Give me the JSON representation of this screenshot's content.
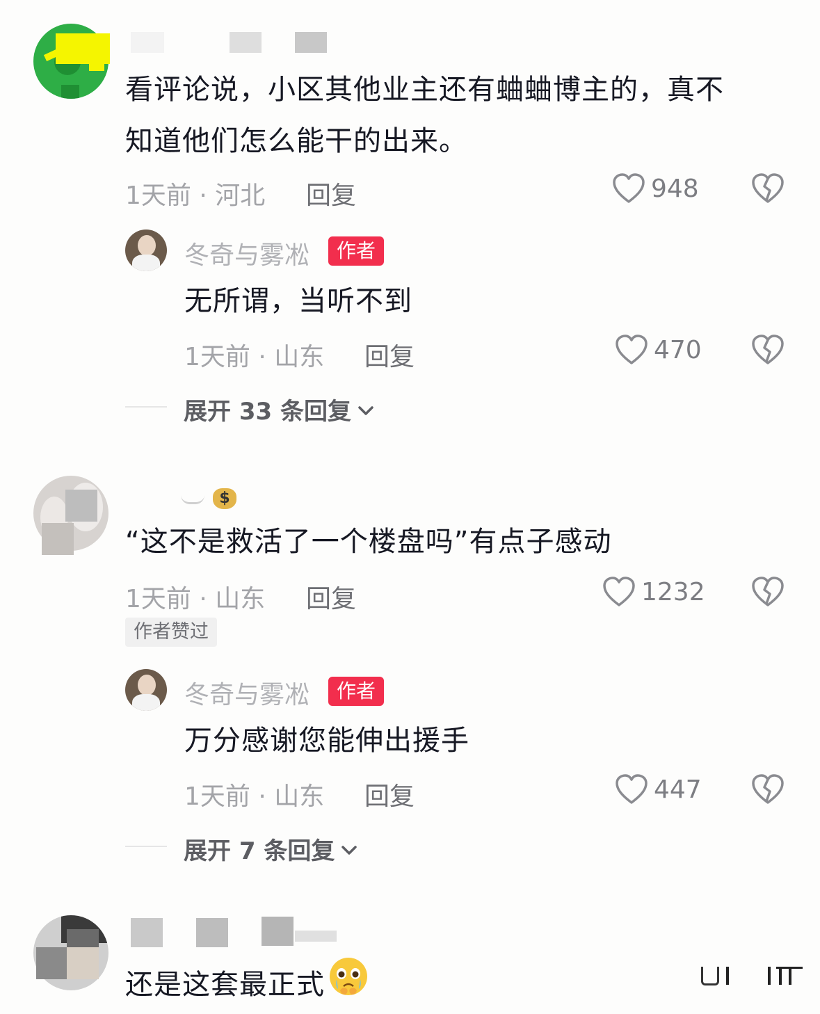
{
  "comments": [
    {
      "content_line1": "看评论说，小区其他业主还有蛐蛐博主的，真不",
      "content_line2": "知道他们怎么能干的出来。",
      "meta": "1天前 · 河北",
      "reply_label": "回复",
      "likes": "948",
      "author_reply": {
        "name": "冬奇与雾凇",
        "badge": "作者",
        "content": "无所谓，当听不到",
        "meta": "1天前 · 山东",
        "reply_label": "回复",
        "likes": "470"
      },
      "expand_label": "展开 33 条回复"
    },
    {
      "content": "“这不是救活了一个楼盘吗”有点子感动",
      "meta": "1天前 · 山东",
      "reply_label": "回复",
      "likes": "1232",
      "liked_by_author": "作者赞过",
      "author_reply": {
        "name": "冬奇与雾凇",
        "badge": "作者",
        "content": "万分感谢您能伸出援手",
        "meta": "1天前 · 山东",
        "reply_label": "回复",
        "likes": "447"
      },
      "expand_label": "展开 7 条回复"
    },
    {
      "content": "还是这套最正式"
    }
  ],
  "icons": {
    "like": "heart-outline-icon",
    "dislike": "broken-heart-icon",
    "expand": "chevron-down-icon",
    "emoji": "pleading-crying-emoji-icon"
  },
  "colors": {
    "author_badge": "#f22e4d",
    "text_primary": "#161823",
    "text_meta": "#a3a4a8"
  }
}
